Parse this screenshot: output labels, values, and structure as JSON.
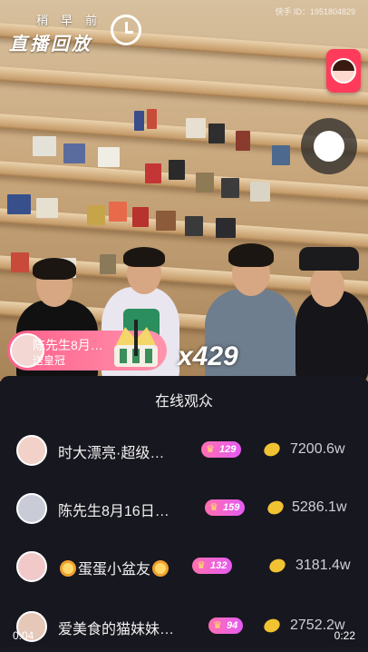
{
  "overlay": {
    "replay_small": "稍早前",
    "replay_big": "直播回放",
    "user_id": "快手 ID：1951804829"
  },
  "gift_banner": {
    "sender": "陈先生8月…",
    "action": "送皇冠",
    "count": "x429"
  },
  "panel": {
    "title": "在线观众",
    "viewers": [
      {
        "nickname": "时大漂亮·超级…",
        "level": "129",
        "score": "7200.6w",
        "avatar_color": "#f2d2c8"
      },
      {
        "nickname": "陈先生8月16日…",
        "level": "159",
        "score": "5286.1w",
        "avatar_color": "#c9ccd6"
      },
      {
        "nickname": "蛋蛋小盆友",
        "level": "132",
        "score": "3181.4w",
        "avatar_color": "#f0c9c8",
        "has_emoji": true
      },
      {
        "nickname": "爱美食的猫妹妹…",
        "level": "94",
        "score": "2752.2w",
        "avatar_color": "#e6c8b8"
      }
    ]
  },
  "player": {
    "elapsed": "0:04",
    "duration": "0:22"
  },
  "colors": {
    "accent_pink": "#ff5f8a",
    "level_badge": "#e45bf2",
    "panel_bg": "#17171f"
  }
}
